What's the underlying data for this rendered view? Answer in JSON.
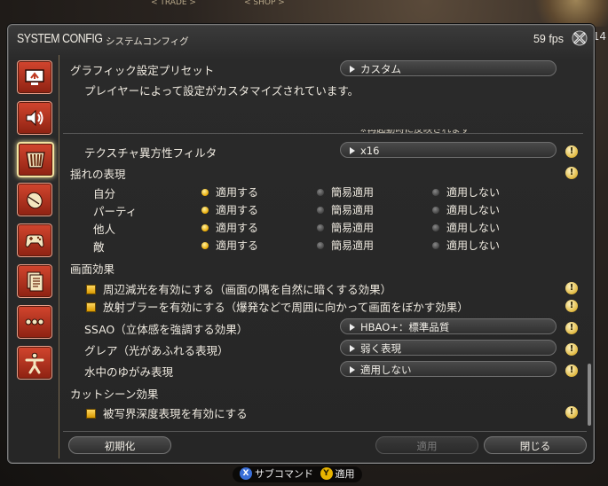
{
  "background": {
    "hud_left": "< TRADE >",
    "hud_right": "< SHOP >",
    "counter": "14"
  },
  "window": {
    "title": "SYSTEM CONFIG",
    "subtitle": "システムコンフィグ",
    "fps": "59 fps"
  },
  "sidebar": {
    "items": [
      {
        "icon": "display-settings-icon"
      },
      {
        "icon": "sound-icon"
      },
      {
        "icon": "graphics-icon",
        "active": true
      },
      {
        "icon": "mouse-icon"
      },
      {
        "icon": "gamepad-icon"
      },
      {
        "icon": "log-document-icon"
      },
      {
        "icon": "other-settings-icon"
      },
      {
        "icon": "accessibility-icon"
      }
    ]
  },
  "preset": {
    "label": "グラフィック設定プリセット",
    "value": "カスタム",
    "description": "プレイヤーによって設定がカスタマイズされています。"
  },
  "restart_note": "※再起動時に反映されます",
  "texture_filter": {
    "label": "テクスチャ異方性フィルタ",
    "value": "x16"
  },
  "sway": {
    "section": "揺れの表現",
    "options": [
      "適用する",
      "簡易適用",
      "適用しない"
    ],
    "rows": [
      {
        "label": "自分",
        "selected": 0
      },
      {
        "label": "パーティ",
        "selected": 0
      },
      {
        "label": "他人",
        "selected": 0
      },
      {
        "label": "敵",
        "selected": 0
      }
    ]
  },
  "screen_effects": {
    "section": "画面効果",
    "limb_darkening": "周辺減光を有効にする（画面の隅を自然に暗くする効果）",
    "radial_blur": "放射ブラーを有効にする（爆発などで周囲に向かって画面をぼかす効果）",
    "ssao": {
      "label": "SSAO（立体感を強調する効果）",
      "value": "HBAO+：標準品質"
    },
    "glare": {
      "label": "グレア（光があふれる表現）",
      "value": "弱く表現"
    },
    "water_distortion": {
      "label": "水中のゆがみ表現",
      "value": "適用しない"
    }
  },
  "cutscene": {
    "section": "カットシーン効果",
    "depth_of_field": "被写界深度表現を有効にする"
  },
  "info_glyph": "!",
  "buttons": {
    "reset": "初期化",
    "apply": "適用",
    "close": "閉じる"
  },
  "hints": {
    "x_glyph": "X",
    "x_label": "サブコマンド",
    "y_glyph": "Y",
    "y_label": "適用"
  },
  "colors": {
    "accent_red": "#c03a22",
    "radio_on": "#e8a800",
    "pad_x": "#3a6fd8",
    "pad_y": "#e8b400"
  }
}
